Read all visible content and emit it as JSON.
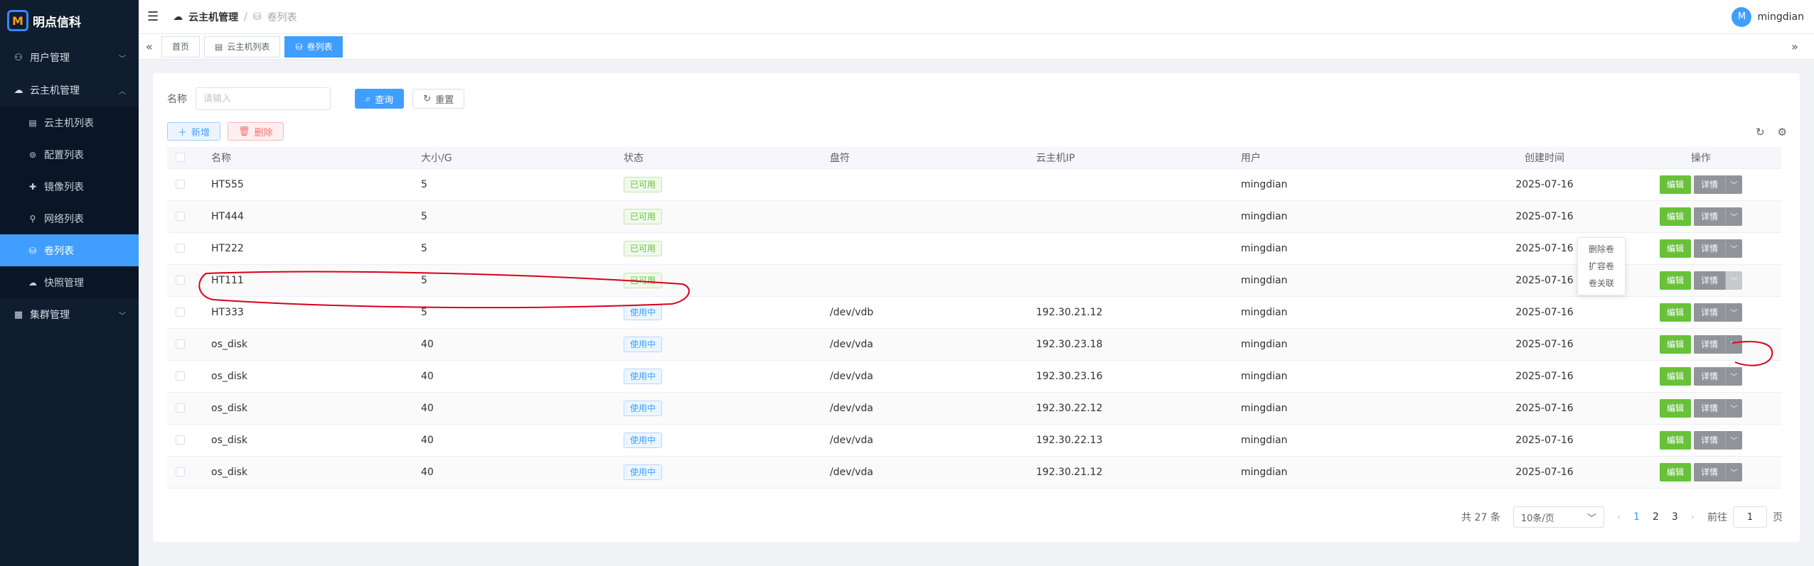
{
  "brand": {
    "logo_mark": "M",
    "name": "明点信科"
  },
  "sidebar": {
    "items": [
      {
        "label": "用户管理",
        "icon": "users-icon",
        "expanded": false
      },
      {
        "label": "云主机管理",
        "icon": "cloud-icon",
        "expanded": true,
        "children": [
          {
            "label": "云主机列表",
            "icon": "clipboard-icon"
          },
          {
            "label": "配置列表",
            "icon": "settings-icon"
          },
          {
            "label": "镜像列表",
            "icon": "image-icon"
          },
          {
            "label": "网络列表",
            "icon": "location-icon"
          },
          {
            "label": "卷列表",
            "icon": "disk-icon",
            "active": true
          },
          {
            "label": "快照管理",
            "icon": "cloud-icon"
          }
        ]
      },
      {
        "label": "集群管理",
        "icon": "cluster-icon",
        "expanded": false
      }
    ]
  },
  "header": {
    "breadcrumb": [
      "云主机管理",
      "卷列表"
    ],
    "user": {
      "avatar": "M",
      "name": "mingdian"
    }
  },
  "tabs": [
    "首页",
    "云主机列表",
    "卷列表"
  ],
  "search": {
    "label": "名称",
    "placeholder": "请输入",
    "query_label": "查询",
    "reset_label": "重置"
  },
  "actions": {
    "add_label": "新增",
    "delete_label": "删除"
  },
  "table": {
    "columns": [
      "名称",
      "大小/G",
      "状态",
      "盘符",
      "云主机IP",
      "用户",
      "创建时间",
      "操作"
    ],
    "rows": [
      {
        "name": "HT555",
        "size": "5",
        "status": "已可用",
        "mount": "",
        "ip": "",
        "user": "mingdian",
        "created": "2025-07-16"
      },
      {
        "name": "HT444",
        "size": "5",
        "status": "已可用",
        "mount": "",
        "ip": "",
        "user": "mingdian",
        "created": "2025-07-16"
      },
      {
        "name": "HT222",
        "size": "5",
        "status": "已可用",
        "mount": "",
        "ip": "",
        "user": "mingdian",
        "created": "2025-07-16"
      },
      {
        "name": "HT111",
        "size": "5",
        "status": "已可用",
        "mount": "",
        "ip": "",
        "user": "mingdian",
        "created": "2025-07-16"
      },
      {
        "name": "HT333",
        "size": "5",
        "status": "使用中",
        "mount": "/dev/vdb",
        "ip": "192.30.21.12",
        "user": "mingdian",
        "created": "2025-07-16"
      },
      {
        "name": "os_disk",
        "size": "40",
        "status": "使用中",
        "mount": "/dev/vda",
        "ip": "192.30.23.18",
        "user": "mingdian",
        "created": "2025-07-16"
      },
      {
        "name": "os_disk",
        "size": "40",
        "status": "使用中",
        "mount": "/dev/vda",
        "ip": "192.30.23.16",
        "user": "mingdian",
        "created": "2025-07-16"
      },
      {
        "name": "os_disk",
        "size": "40",
        "status": "使用中",
        "mount": "/dev/vda",
        "ip": "192.30.22.12",
        "user": "mingdian",
        "created": "2025-07-16"
      },
      {
        "name": "os_disk",
        "size": "40",
        "status": "使用中",
        "mount": "/dev/vda",
        "ip": "192.30.22.13",
        "user": "mingdian",
        "created": "2025-07-16"
      },
      {
        "name": "os_disk",
        "size": "40",
        "status": "使用中",
        "mount": "/dev/vda",
        "ip": "192.30.21.12",
        "user": "mingdian",
        "created": "2025-07-16"
      }
    ],
    "op_labels": {
      "edit": "编辑",
      "detail": "详情"
    }
  },
  "dropdown": {
    "items": [
      "删除卷",
      "扩容卷",
      "卷关联"
    ]
  },
  "pagination": {
    "total_label": "共 27 条",
    "page_size": "10条/页",
    "pages": [
      "1",
      "2",
      "3"
    ],
    "current": "1",
    "goto_prefix": "前往",
    "goto_value": "1",
    "goto_suffix": "页"
  },
  "colors": {
    "accent": "#409eff",
    "sidebar_bg": "#0f1d2f",
    "success": "#67c23a",
    "annotation": "#d9001b"
  }
}
